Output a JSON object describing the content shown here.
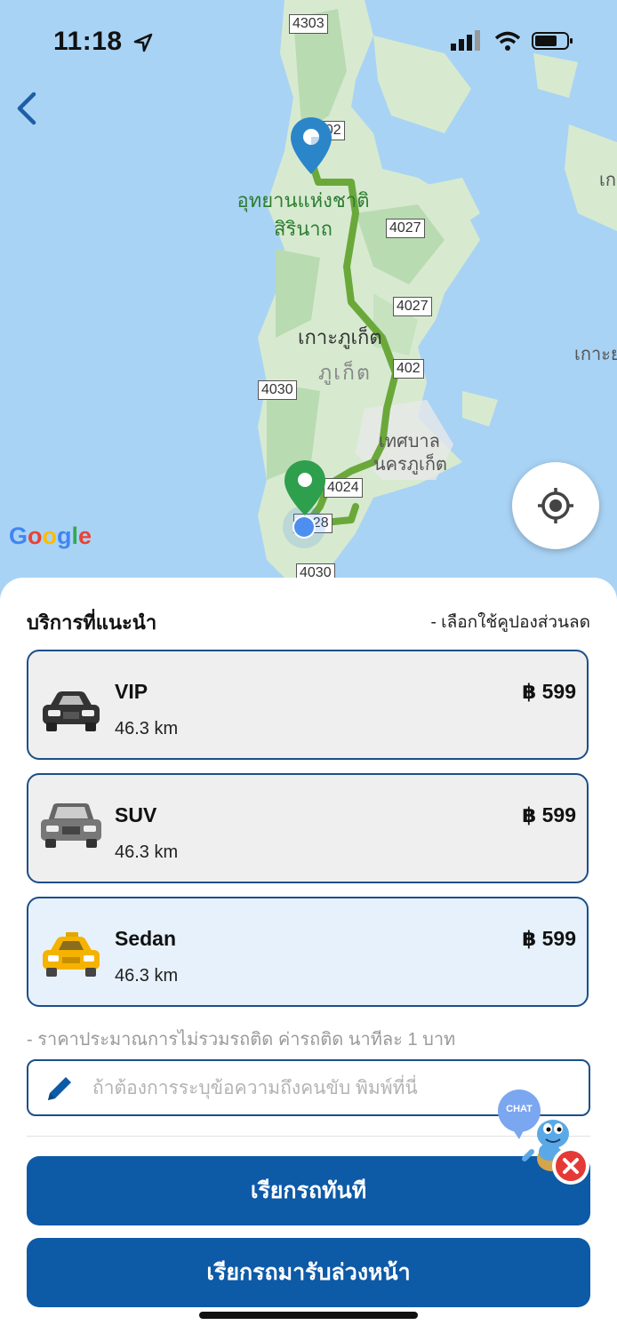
{
  "status_bar": {
    "time": "11:18"
  },
  "map": {
    "labels": {
      "park_line1": "อุทยานแห่งชาติ",
      "park_line2": "สิรินาถ",
      "island_name": "เกาะภูเก็ต",
      "province": "ภูเก็ต",
      "municipality_line1": "เทศบาล",
      "municipality_line2": "นครภูเก็ต",
      "right_island_1": "เก",
      "right_island_2": "เกาะย"
    },
    "road_shields": [
      "4303",
      "402",
      "4027",
      "4027",
      "4030",
      "402",
      "4024",
      "4028",
      "4030"
    ],
    "google_logo": "Google"
  },
  "section": {
    "title": "บริการที่แนะนำ",
    "coupon_link": "- เลือกใช้คูปองส่วนลด"
  },
  "cars": [
    {
      "name": "VIP",
      "distance": "46.3 km",
      "price": "฿ 599",
      "icon": "car-black-icon",
      "selected": false
    },
    {
      "name": "SUV",
      "distance": "46.3 km",
      "price": "฿ 599",
      "icon": "suv-gray-icon",
      "selected": false
    },
    {
      "name": "Sedan",
      "distance": "46.3 km",
      "price": "฿ 599",
      "icon": "taxi-yellow-icon",
      "selected": true
    }
  ],
  "price_note": "- ราคาประมาณการไม่รวมรถติด ค่ารถติด นาทีละ 1 บาท",
  "message_input": {
    "placeholder": "ถ้าต้องการระบุข้อความถึงคนขับ พิมพ์ที่นี่",
    "value": ""
  },
  "chat_widget": {
    "label": "CHAT"
  },
  "buttons": {
    "call_now": "เรียกรถทันที",
    "reserve": "เรียกรถมารับล่วงหน้า"
  },
  "colors": {
    "primary": "#0d5aa7",
    "card_border": "#1b4f8a",
    "route": "#6ba83a",
    "start_pin": "#2b86c9",
    "end_pin": "#2e9f4c"
  }
}
